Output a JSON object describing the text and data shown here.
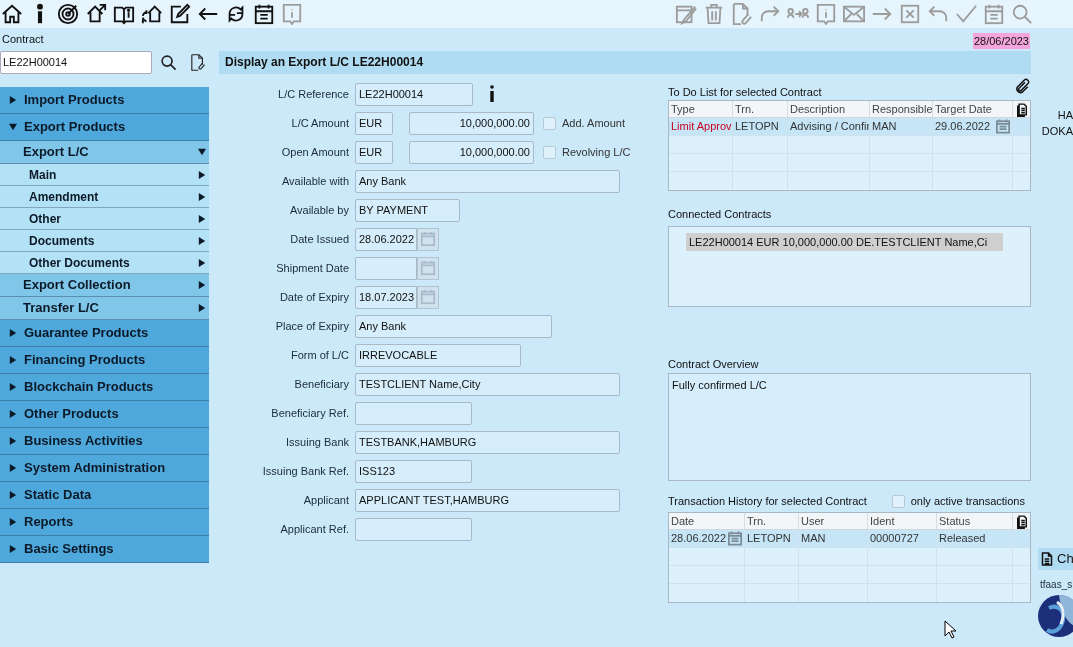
{
  "toolbar": {
    "left": [
      {
        "disabled": false
      },
      {
        "disabled": false
      },
      {
        "disabled": false
      },
      {
        "disabled": false
      },
      {
        "disabled": false
      },
      {
        "disabled": false
      },
      {
        "disabled": false
      },
      {
        "disabled": false
      },
      {
        "disabled": false
      },
      {
        "disabled": false
      },
      {
        "disabled": true
      }
    ],
    "right": [
      {
        "disabled": true
      },
      {
        "disabled": true
      },
      {
        "disabled": true
      },
      {
        "disabled": true
      },
      {
        "disabled": true
      },
      {
        "disabled": true
      },
      {
        "disabled": true
      },
      {
        "disabled": true
      },
      {
        "disabled": true
      },
      {
        "disabled": true
      },
      {
        "disabled": true
      },
      {
        "disabled": true
      },
      {
        "disabled": true
      }
    ]
  },
  "contract": {
    "label": "Contract",
    "value": "LE22H00014"
  },
  "date": "28/06/2023",
  "title": "Display an Export L/C LE22H00014",
  "menu": [
    {
      "label": "Import Products",
      "expanded": false
    },
    {
      "label": "Export Products",
      "expanded": true,
      "children": [
        {
          "label": "Export L/C",
          "expanded": true,
          "children": [
            {
              "label": "Main",
              "expanded": false
            },
            {
              "label": "Amendment",
              "expanded": false
            },
            {
              "label": "Other",
              "expanded": false
            },
            {
              "label": "Documents",
              "expanded": false
            },
            {
              "label": "Other Documents",
              "expanded": false
            }
          ]
        },
        {
          "label": "Export Collection",
          "expanded": false
        },
        {
          "label": "Transfer L/C",
          "expanded": false
        }
      ]
    },
    {
      "label": "Guarantee Products",
      "expanded": false
    },
    {
      "label": "Financing Products",
      "expanded": false
    },
    {
      "label": "Blockchain Products",
      "expanded": false
    },
    {
      "label": "Other Products",
      "expanded": false
    },
    {
      "label": "Business Activities",
      "expanded": false
    },
    {
      "label": "System Administration",
      "expanded": false
    },
    {
      "label": "Static Data",
      "expanded": false
    },
    {
      "label": "Reports",
      "expanded": false
    },
    {
      "label": "Basic Settings",
      "expanded": false
    }
  ],
  "form": [
    {
      "kind": "text",
      "label": "L/C Reference",
      "value": "LE22H00014",
      "info": true
    },
    {
      "kind": "amount",
      "label": "L/C Amount",
      "currency": "EUR",
      "amount": "10,000,000.00",
      "option": {
        "label": "Add. Amount",
        "checked": false
      }
    },
    {
      "kind": "amount",
      "label": "Open Amount",
      "currency": "EUR",
      "amount": "10,000,000.00",
      "option": {
        "label": "Revolving L/C",
        "checked": false
      }
    },
    {
      "kind": "text",
      "label": "Available with",
      "value": "Any Bank"
    },
    {
      "kind": "text",
      "label": "Available by",
      "value": "BY PAYMENT"
    },
    {
      "kind": "date",
      "label": "Date Issued",
      "value": "28.06.2022"
    },
    {
      "kind": "date",
      "label": "Shipment Date"
    },
    {
      "kind": "date",
      "label": "Date of Expiry",
      "value": "18.07.2023"
    },
    {
      "kind": "text",
      "label": "Place of Expiry",
      "value": "Any Bank"
    },
    {
      "kind": "text",
      "label": "Form of L/C",
      "value": "IRREVOCABLE"
    },
    {
      "kind": "text",
      "label": "Beneficiary",
      "value": "TESTCLIENT Name,City"
    },
    {
      "kind": "text",
      "label": "Beneficiary Ref."
    },
    {
      "kind": "text",
      "label": "Issuing Bank",
      "value": "TESTBANK,HAMBURG"
    },
    {
      "kind": "text",
      "label": "Issuing Bank Ref.",
      "value": "ISS123"
    },
    {
      "kind": "text",
      "label": "Applicant",
      "value": "APPLICANT TEST,HAMBURG"
    },
    {
      "kind": "text",
      "label": "Applicant Ref."
    }
  ],
  "todo": {
    "title": "To Do List for selected Contract",
    "columns": [
      {
        "label": "Type"
      },
      {
        "label": "Trn."
      },
      {
        "label": "Description"
      },
      {
        "label": "Responsible"
      },
      {
        "label": "Target Date",
        "kind": "date"
      }
    ],
    "rows": [
      {
        "selected": true,
        "cells": [
          "Limit Approv",
          "LETOPN",
          "Advising / Confir",
          "MAN",
          "29.06.2022"
        ]
      }
    ]
  },
  "connected": {
    "title": "Connected Contracts",
    "items": [
      {
        "text": "LE22H00014 EUR 10,000,000.00 DE.TESTCLIENT Name,Ci",
        "selected": true
      }
    ]
  },
  "overview": {
    "title": "Contract Overview",
    "text": "Fully confirmed L/C"
  },
  "history": {
    "title": "Transaction History for selected Contract",
    "filter": {
      "label": "only active transactions",
      "checked": false
    },
    "columns": [
      {
        "label": "Date",
        "kind": "date"
      },
      {
        "label": "Trn."
      },
      {
        "label": "User"
      },
      {
        "label": "Ident"
      },
      {
        "label": "Status"
      }
    ],
    "rows": [
      {
        "selected": true,
        "cells": [
          "28.06.2022",
          "LETOPN",
          "MAN",
          "00000727",
          "Released"
        ]
      }
    ]
  },
  "side": {
    "lines": [
      "HA",
      "DOKA"
    ],
    "button": "Ch",
    "user": "tfaas_s"
  }
}
